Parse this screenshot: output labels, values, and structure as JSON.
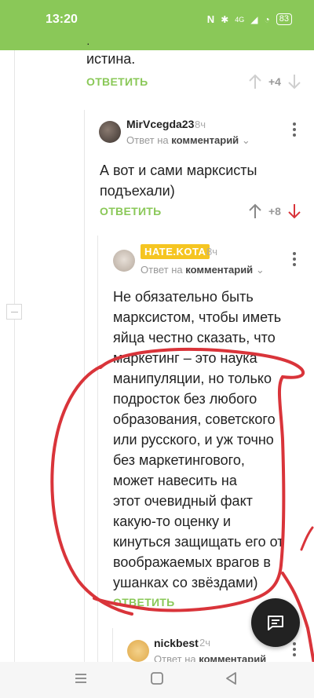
{
  "status": {
    "time": "13:20",
    "battery": "83",
    "network": "4G",
    "nfc_icon": "nfc-icon",
    "bt_icon": "bluetooth-icon"
  },
  "comment0": {
    "text_tail": "истина.",
    "reply": "ОТВЕТИТЬ",
    "score": "+4"
  },
  "comment1": {
    "author": "MirVcegda23",
    "time": "8ч",
    "meta_prefix": "Ответ на",
    "meta_link": "комментарий",
    "text_lines": [
      "А вот и сами марксисты",
      "подъехали)"
    ],
    "reply": "ОТВЕТИТЬ",
    "score": "+8"
  },
  "comment2": {
    "author": "HATE.KOTA",
    "time": "8ч",
    "meta_prefix": "Ответ на",
    "meta_link": "комментарий",
    "text_lines": [
      "Не обязательно быть",
      "марксистом, чтобы иметь",
      "яйца честно сказать, что",
      "маркетинг – это наука",
      "манипуляции, но только",
      "подросток без любого",
      "образования, советского",
      "или русского, и уж точно",
      "без маркетингового,",
      "может навесить на",
      "этот очевидный факт",
      "какую-то оценку и",
      "кинуться защищать его от",
      "воображаемых врагов в",
      "ушанках со звёздами)"
    ],
    "reply": "ОТВЕТИТЬ"
  },
  "comment3": {
    "author": "nickbest",
    "time": "2ч",
    "meta_prefix": "Ответ на",
    "meta_link": "комментарий"
  },
  "colors": {
    "accent": "#8ac858",
    "annotation": "#d9343a",
    "badge": "#f5c521"
  }
}
